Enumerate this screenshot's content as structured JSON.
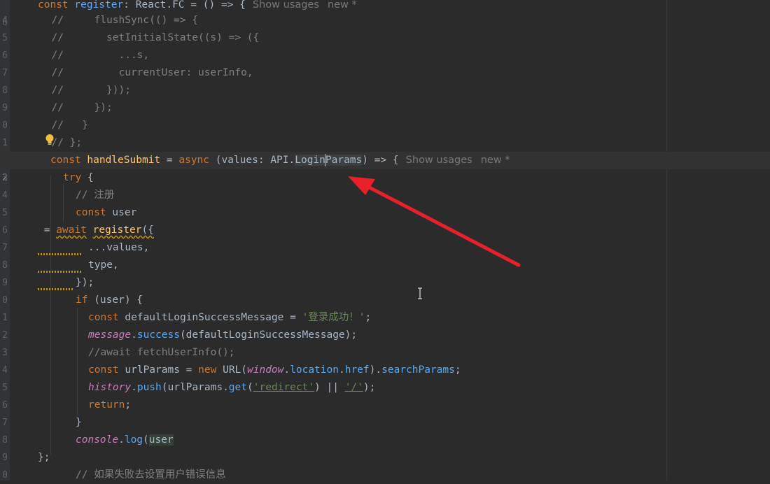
{
  "editor": {
    "line_numbers": [
      "6",
      "4",
      "5",
      "6",
      "7",
      "8",
      "9",
      "0",
      "1",
      "2",
      "3",
      "4",
      "5",
      "6",
      "7",
      "8",
      "9",
      "0",
      "1",
      "2",
      "3",
      "4",
      "5",
      "6",
      "7",
      "8",
      "9",
      "0"
    ],
    "hints": {
      "show_usages": "Show usages",
      "new": "new *"
    },
    "colors": {
      "background": "#2b2b2b",
      "keyword": "#cc7832",
      "string": "#6a8759",
      "comment": "#808080",
      "arrow": "#e8202a"
    }
  },
  "code": {
    "l0": {
      "kw": "const ",
      "name": "register",
      "rest": ": React.FC = () => {"
    },
    "l1": "  //     flushSync(() => {",
    "l2": "  //       setInitialState((s) => ({",
    "l3": "  //         ...s,",
    "l4": "  //         currentUser: userInfo,",
    "l5": "  //       }));",
    "l6": "  //     });",
    "l7": "  //   }",
    "l8": "  // };",
    "l9": {
      "kw1": "const ",
      "name": "handleSubmit",
      "eq": " = ",
      "kw2": "async",
      "p1": " (values: API.",
      "sel": "Login",
      "sel2": "Params",
      "p2": ") => {"
    },
    "l10": {
      "kw": "try",
      "rest": " {"
    },
    "l11": "// 注册",
    "l12": {
      "kw": "const",
      "rest": " user"
    },
    "l13": {
      "eq": " = ",
      "kw": "await",
      "fn": "register",
      "rest": "({"
    },
    "l14": "...values,",
    "l15": "type,",
    "l16": "});",
    "l17": {
      "kw": "if",
      "rest": " (user) {"
    },
    "l18": {
      "kw": "const",
      "rest": " defaultLoginSuccessMessage = ",
      "str": "'登录成功！'",
      "end": ";"
    },
    "l19": {
      "obj": "message",
      "dot": ".",
      "fn": "success",
      "rest": "(defaultLoginSuccessMessage);"
    },
    "l20": "//await fetchUserInfo();",
    "l21": {
      "kw": "const",
      "a": " urlParams = ",
      "kw2": "new",
      "b": " URL(",
      "win": "window",
      "c": ".",
      "loc": "location",
      "d": ".",
      "href": "href",
      "e": ").",
      "sp": "searchParams",
      "f": ";"
    },
    "l22": {
      "obj": "history",
      "dot": ".",
      "fn": "push",
      "a": "(urlParams.",
      "get": "get",
      "b": "(",
      "s1": "'redirect'",
      "c": ") || ",
      "s2": "'/'",
      "d": ");"
    },
    "l23": {
      "kw": "return",
      "rest": ";"
    },
    "l24": "}",
    "l25": {
      "obj": "console",
      "dot": ".",
      "fn": "log",
      "a": "(",
      "hl": "user"
    },
    "l26": "};",
    "l27": "// 如果失败去设置用户错误信息"
  }
}
